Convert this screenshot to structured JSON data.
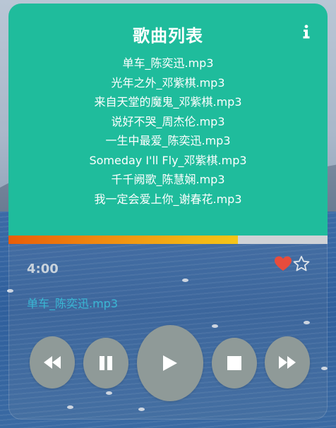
{
  "playlist": {
    "title": "歌曲列表",
    "info_icon": "info-icon",
    "songs": [
      "单车_陈奕迅.mp3",
      "光年之外_邓紫棋.mp3",
      "来自天堂的魔鬼_邓紫棋.mp3",
      "说好不哭_周杰伦.mp3",
      "一生中最爱_陈奕迅.mp3",
      "Someday I'll Fly_邓紫棋.mp3",
      "千千阙歌_陈慧娴.mp3",
      "我一定会爱上你_谢春花.mp3"
    ]
  },
  "player": {
    "progress_fraction": 0.72,
    "time": "4:00",
    "now_playing": "单车_陈奕迅.mp3",
    "favorite_icon": "heart-icon",
    "rating_icon": "star-outline-icon"
  },
  "controls": {
    "icons": [
      "rewind-icon",
      "pause-icon",
      "play-icon",
      "stop-icon",
      "fast-forward-icon"
    ]
  },
  "colors": {
    "panel": "#1fbc9c",
    "progress_start": "#e85d08",
    "progress_end": "#f5c518",
    "heart": "#e74c3c",
    "now_playing_text": "#3ab7d4",
    "control_bg": "#8f9a98"
  }
}
